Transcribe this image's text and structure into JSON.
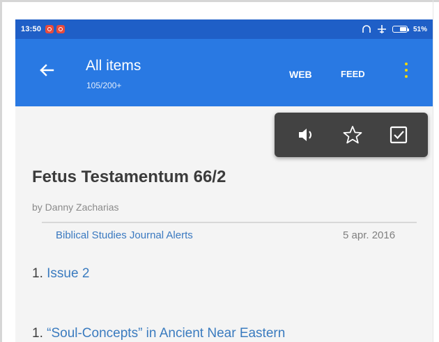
{
  "status_bar": {
    "time": "13:50",
    "battery": "51%"
  },
  "toolbar": {
    "title": "All items",
    "count": "105/200+",
    "web_label": "WEB",
    "feed_label": "FEED"
  },
  "colors": {
    "status_bar": "#1f5fc7",
    "toolbar": "#2979e3",
    "popup": "#424242",
    "link": "#3a7bbf"
  },
  "popup_actions": [
    "speaker-icon",
    "star-icon",
    "checkbox-icon"
  ],
  "article": {
    "title": "Fetus Testamentum 66/2",
    "author": "by Danny Zacharias",
    "feed_name": "Biblical Studies Journal Alerts",
    "date": "5 apr. 2016",
    "items": [
      {
        "number": "1. ",
        "text": "Issue 2"
      },
      {
        "number": "1. ",
        "text": "“Soul-Concepts” in Ancient Near Eastern"
      }
    ]
  }
}
